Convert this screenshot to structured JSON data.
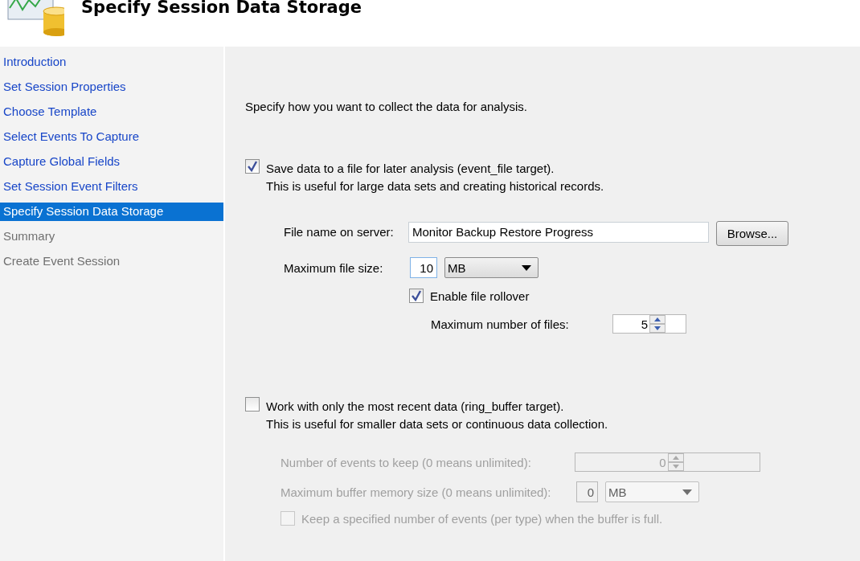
{
  "header": {
    "title": "Specify Session Data Storage"
  },
  "sidebar": {
    "items": [
      {
        "label": "Introduction",
        "selected": false,
        "disabled": false
      },
      {
        "label": "Set Session Properties",
        "selected": false,
        "disabled": false
      },
      {
        "label": "Choose Template",
        "selected": false,
        "disabled": false
      },
      {
        "label": "Select Events To Capture",
        "selected": false,
        "disabled": false
      },
      {
        "label": "Capture Global Fields",
        "selected": false,
        "disabled": false
      },
      {
        "label": "Set Session Event Filters",
        "selected": false,
        "disabled": false
      },
      {
        "label": "Specify Session Data Storage",
        "selected": true,
        "disabled": false
      },
      {
        "label": "Summary",
        "selected": false,
        "disabled": true
      },
      {
        "label": "Create Event Session",
        "selected": false,
        "disabled": true
      }
    ]
  },
  "main": {
    "intro": "Specify how you want to collect the data for analysis.",
    "options": [
      {
        "checked": true,
        "title": "Save data to a file for later analysis (event_file target).",
        "description": "This is useful for large data sets and creating historical records.",
        "fields": [
          {
            "kind": "text",
            "label": "File name on server:",
            "value": "Monitor Backup Restore Progress",
            "button": "Browse...",
            "disabled": false
          },
          {
            "kind": "size",
            "label": "Maximum file size:",
            "value": "10",
            "unit": "MB",
            "disabled": false
          },
          {
            "kind": "checkbox",
            "label": "Enable file rollover",
            "checked": true,
            "disabled": false
          },
          {
            "kind": "spinner",
            "label": "Maximum number of files:",
            "value": "5",
            "disabled": false
          }
        ]
      },
      {
        "checked": false,
        "title": "Work with only the most recent data (ring_buffer target).",
        "description": "This is useful for smaller data sets or continuous data collection.",
        "fields": [
          {
            "kind": "spinner",
            "label": "Number of events to keep (0 means unlimited):",
            "value": "0",
            "disabled": true
          },
          {
            "kind": "size",
            "label": "Maximum buffer memory size (0 means unlimited):",
            "value": "0",
            "unit": "MB",
            "disabled": true
          },
          {
            "kind": "checkbox",
            "label": "Keep a specified number of events (per type) when the buffer is full.",
            "checked": false,
            "disabled": true
          }
        ]
      }
    ]
  }
}
